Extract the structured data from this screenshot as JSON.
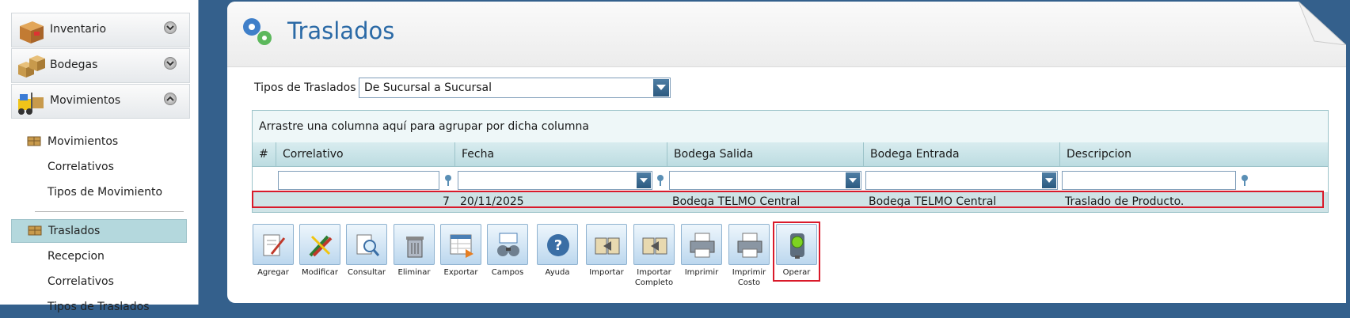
{
  "sidebar": {
    "sections": [
      {
        "label": "Inventario",
        "icon": "box-icon"
      },
      {
        "label": "Bodegas",
        "icon": "boxes-icon"
      },
      {
        "label": "Movimientos",
        "icon": "forklift-icon"
      }
    ],
    "items": [
      {
        "label": "Movimientos"
      },
      {
        "label": "Correlativos"
      },
      {
        "label": "Tipos de Movimiento"
      },
      {
        "label": "Traslados",
        "active": true
      },
      {
        "label": "Recepcion"
      },
      {
        "label": "Correlativos"
      },
      {
        "label": "Tipos de Traslados"
      }
    ]
  },
  "header": {
    "title": "Traslados"
  },
  "filter": {
    "label": "Tipos de Traslados",
    "selected": "De Sucursal a Sucursal"
  },
  "grid": {
    "group_hint": "Arrastre una columna aquí para agrupar por dicha columna",
    "columns": [
      "#",
      "Correlativo",
      "Fecha",
      "Bodega Salida",
      "Bodega Entrada",
      "Descripcion"
    ],
    "rows": [
      {
        "correlativo": "7",
        "fecha": "20/11/2025",
        "bodega_salida": "Bodega TELMO Central",
        "bodega_entrada": "Bodega TELMO Central",
        "descripcion": "Traslado de Producto."
      }
    ]
  },
  "toolbar": {
    "agregar": "Agregar",
    "modificar": "Modificar",
    "consultar": "Consultar",
    "eliminar": "Eliminar",
    "exportar": "Exportar",
    "campos": "Campos",
    "ayuda": "Ayuda",
    "importar": "Importar",
    "importar_completo": "Importar Completo",
    "imprimir": "Imprimir",
    "imprimir_costo": "Imprimir Costo",
    "operar": "Operar"
  },
  "colors": {
    "accent": "#2b6aa6",
    "background": "#34608c",
    "active_row": "#cfe3e6",
    "highlight": "#d91a2a"
  }
}
